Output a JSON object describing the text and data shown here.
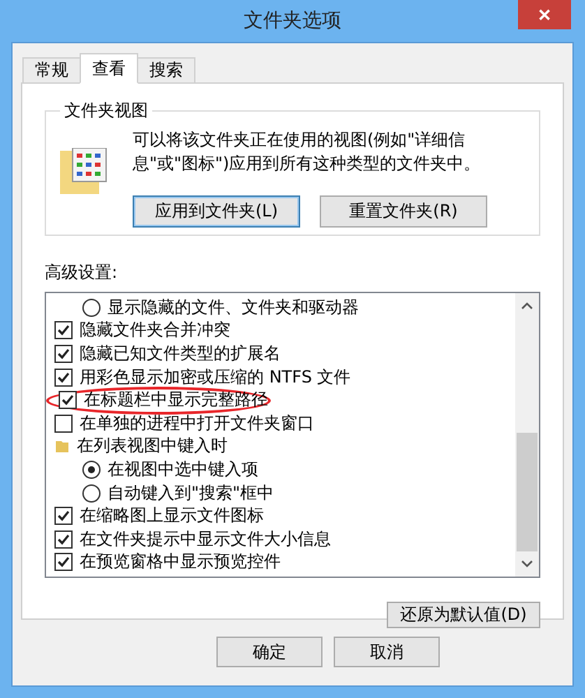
{
  "window": {
    "title": "文件夹选项",
    "close": "✕"
  },
  "tabs": [
    {
      "label": "常规",
      "selected": false
    },
    {
      "label": "查看",
      "selected": true
    },
    {
      "label": "搜索",
      "selected": false
    }
  ],
  "folder_views": {
    "title": "文件夹视图",
    "description": "可以将该文件夹正在使用的视图(例如\"详细信息\"或\"图标\")应用到所有这种类型的文件夹中。",
    "buttons": [
      {
        "label": "应用到文件夹(L)",
        "focused": true
      },
      {
        "label": "重置文件夹(R)",
        "focused": false
      }
    ]
  },
  "advanced": {
    "title": "高级设置:",
    "items": [
      {
        "kind": "radio",
        "label": "显示隐藏的文件、文件夹和驱动器",
        "checked": false,
        "highlighted": false
      },
      {
        "kind": "checkbox",
        "label": "隐藏文件夹合并冲突",
        "checked": true,
        "highlighted": false
      },
      {
        "kind": "checkbox",
        "label": "隐藏已知文件类型的扩展名",
        "checked": true,
        "highlighted": false
      },
      {
        "kind": "checkbox",
        "label": "用彩色显示加密或压缩的 NTFS 文件",
        "checked": true,
        "highlighted": false
      },
      {
        "kind": "checkbox",
        "label": "在标题栏中显示完整路径",
        "checked": true,
        "highlighted": true
      },
      {
        "kind": "checkbox",
        "label": "在单独的进程中打开文件夹窗口",
        "checked": false,
        "highlighted": false
      },
      {
        "kind": "folder",
        "label": "在列表视图中键入时",
        "highlighted": false,
        "children": [
          {
            "kind": "radio",
            "label": "在视图中选中键入项",
            "checked": true,
            "highlighted": false
          },
          {
            "kind": "radio",
            "label": "自动键入到\"搜索\"框中",
            "checked": false,
            "highlighted": false
          }
        ]
      },
      {
        "kind": "checkbox",
        "label": "在缩略图上显示文件图标",
        "checked": true,
        "highlighted": false
      },
      {
        "kind": "checkbox",
        "label": "在文件夹提示中显示文件大小信息",
        "checked": true,
        "highlighted": false
      },
      {
        "kind": "checkbox",
        "label": "在预览窗格中显示预览控件",
        "checked": true,
        "highlighted": false
      }
    ],
    "restore_button": "还原为默认值(D)"
  },
  "buttons": [
    "确定",
    "取消"
  ]
}
